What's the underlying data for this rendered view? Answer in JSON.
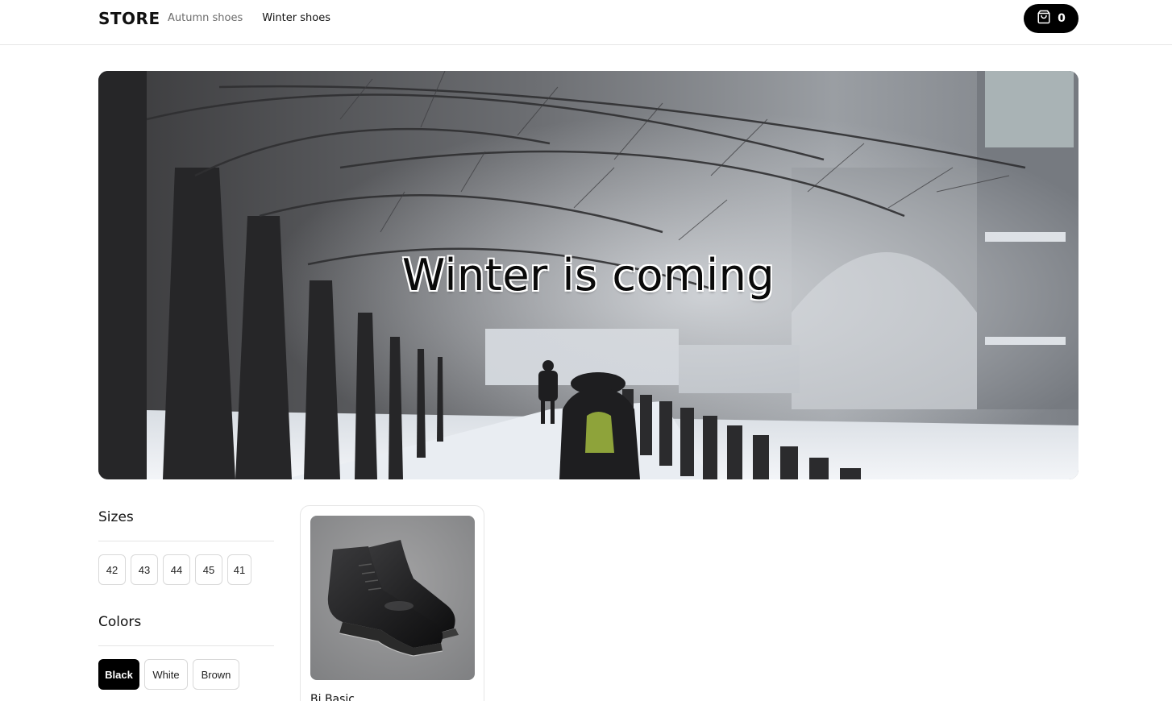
{
  "header": {
    "logo": "STORE",
    "nav": [
      {
        "label": "Autumn shoes",
        "active": false
      },
      {
        "label": "Winter shoes",
        "active": true
      }
    ],
    "cart": {
      "icon": "shopping-bag-icon",
      "count": "0"
    }
  },
  "hero": {
    "title": "Winter is coming",
    "image": "snowy-park-walkway-photo"
  },
  "filters": {
    "sizes": {
      "title": "Sizes",
      "options": [
        "42",
        "43",
        "44",
        "45",
        "41"
      ]
    },
    "colors": {
      "title": "Colors",
      "options": [
        "Black",
        "White",
        "Brown"
      ],
      "selected": "Black"
    }
  },
  "products": [
    {
      "name": "Bi Basic",
      "image": "black-leather-boots-photo"
    }
  ],
  "colors": {
    "accent": "#000000",
    "border": "#e6e6e6",
    "muted_text": "#6b6b6b"
  }
}
